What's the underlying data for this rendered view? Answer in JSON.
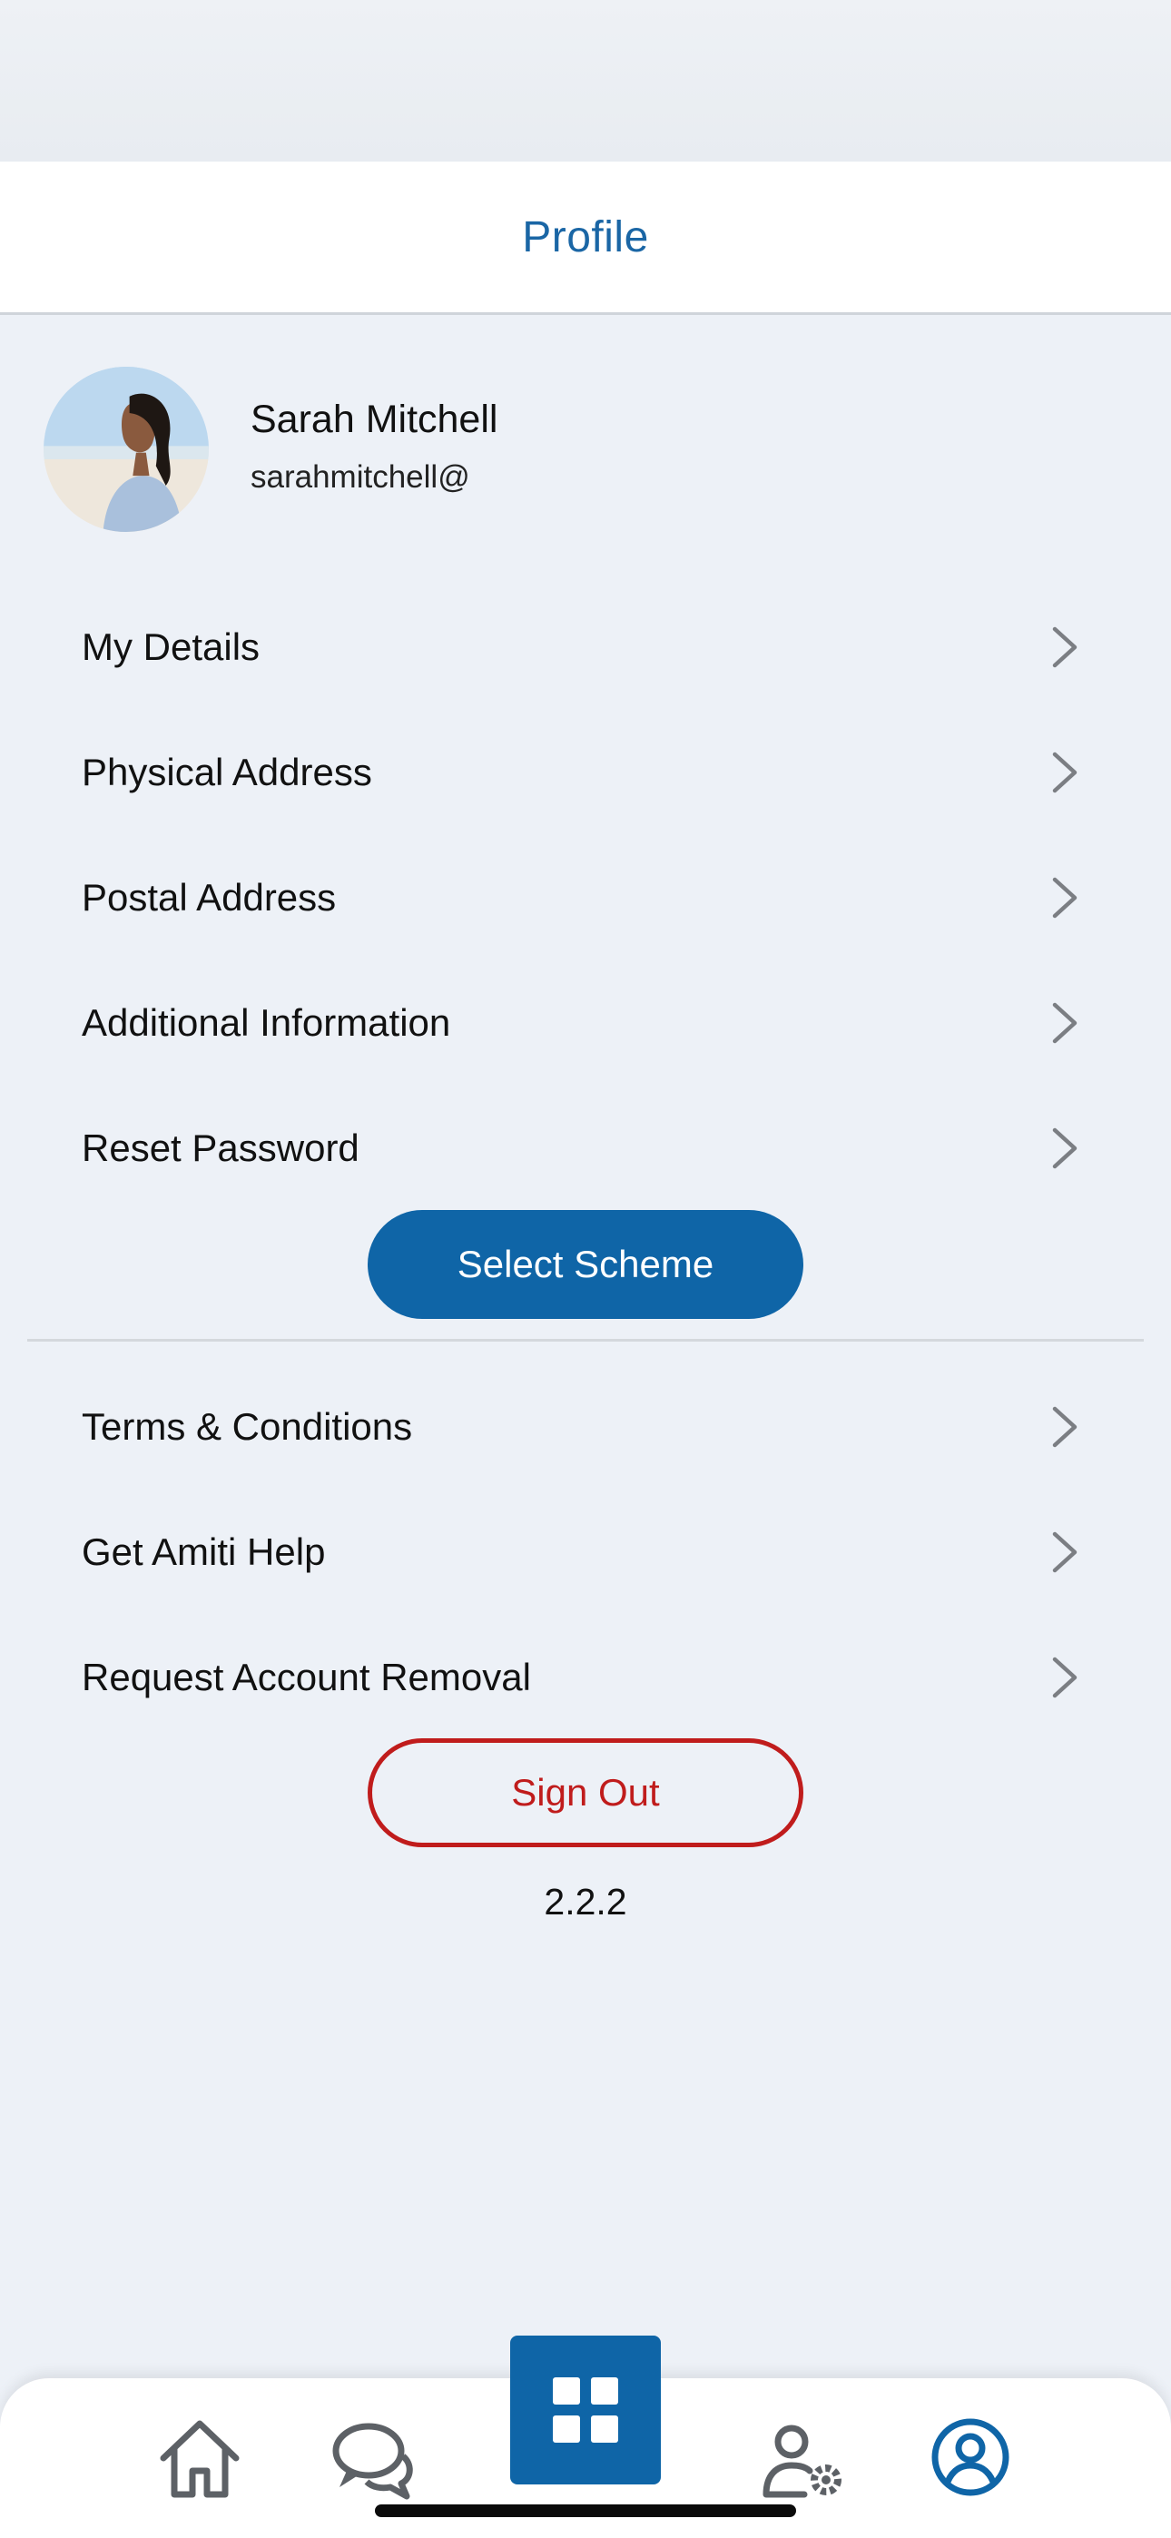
{
  "header": {
    "title": "Profile"
  },
  "profile": {
    "name": "Sarah Mitchell",
    "email": "sarahmitchell@"
  },
  "menu_primary": [
    {
      "label": "My Details"
    },
    {
      "label": "Physical Address"
    },
    {
      "label": "Postal Address"
    },
    {
      "label": "Additional Information"
    },
    {
      "label": "Reset Password"
    }
  ],
  "select_scheme_label": "Select Scheme",
  "menu_secondary": [
    {
      "label": "Terms & Conditions"
    },
    {
      "label": "Get Amiti Help"
    },
    {
      "label": "Request Account Removal"
    }
  ],
  "sign_out_label": "Sign Out",
  "version": "2.2.2",
  "tabbar": {
    "tabs": [
      "home-icon",
      "chat-icon",
      "grid-icon",
      "user-settings-icon",
      "profile-icon"
    ],
    "active": "profile-icon"
  },
  "colors": {
    "accent": "#0f65a7",
    "title": "#1a66a5",
    "danger": "#c01c1c",
    "background": "#edf1f7"
  }
}
